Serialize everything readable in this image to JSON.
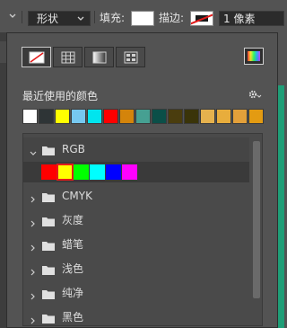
{
  "toolbar": {
    "shape_mode": "形状",
    "fill_label": "填充:",
    "stroke_label": "描边:",
    "stroke_width": "1 像素"
  },
  "panel": {
    "mode_buttons": [
      {
        "icon": "no-color-icon"
      },
      {
        "icon": "solid-color-icon"
      },
      {
        "icon": "gradient-icon"
      },
      {
        "icon": "pattern-icon"
      }
    ],
    "picker_icon": "color-picker-icon",
    "recent_title": "最近使用的颜色",
    "recent_colors": [
      "#ffffff",
      "#2e3436",
      "#ffff00",
      "#76c8f0",
      "#00e5ee",
      "#ff0000",
      "#d4840b",
      "#46a092",
      "#0b4f48",
      "#4a3d0e",
      "#3a3409",
      "#e6b24e",
      "#e8ad3c",
      "#e3a03a",
      "#e39b12"
    ],
    "groups": [
      {
        "name": "RGB",
        "expanded": true,
        "swatches": [
          "#ff0000",
          "#ffff00",
          "#00ff00",
          "#00ffff",
          "#0000ff",
          "#ff00ff"
        ],
        "selected": 1
      },
      {
        "name": "CMYK",
        "expanded": false
      },
      {
        "name": "灰度",
        "expanded": false
      },
      {
        "name": "蜡笔",
        "expanded": false
      },
      {
        "name": "浅色",
        "expanded": false
      },
      {
        "name": "纯净",
        "expanded": false
      },
      {
        "name": "黑色",
        "expanded": false
      }
    ]
  }
}
